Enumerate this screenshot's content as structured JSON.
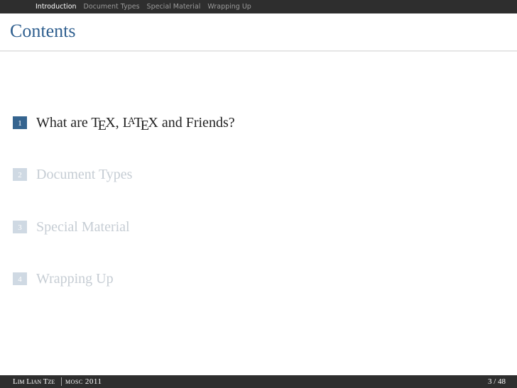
{
  "nav": {
    "sections": [
      "Introduction",
      "Document Types",
      "Special Material",
      "Wrapping Up"
    ],
    "active_index": 0
  },
  "frame": {
    "title": "Contents"
  },
  "toc": {
    "items": [
      {
        "number": "1",
        "label_before": "What are ",
        "label_after": " and Friends?",
        "active": true
      },
      {
        "number": "2",
        "label": "Document Types",
        "active": false
      },
      {
        "number": "3",
        "label": "Special Material",
        "active": false
      },
      {
        "number": "4",
        "label": "Wrapping Up",
        "active": false
      }
    ],
    "tex": {
      "t": "T",
      "e": "E",
      "x": "X",
      "comma": ", ",
      "l": "L",
      "a": "A"
    }
  },
  "footer": {
    "author": "Lim Lian Tze",
    "event": "MOSC 2011",
    "page_current": "3",
    "page_total": "48",
    "page_separator": " / "
  },
  "colors": {
    "bar": "#2e2e2e",
    "title": "#2f5f8f",
    "toc_number_active": "#35648f",
    "toc_number_dim": "#cfd9e3",
    "toc_text_dim": "#c6cdd4"
  }
}
